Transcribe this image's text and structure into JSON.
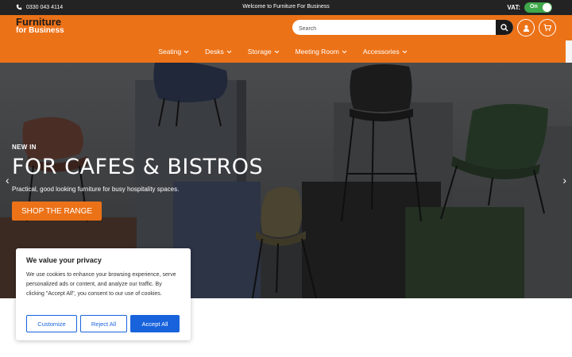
{
  "topbar": {
    "phone": "0330 043 4114",
    "welcome": "Welcome to Furniture For Business",
    "vat_label": "VAT:",
    "vat_toggle": "On",
    "icon": "phone-icon"
  },
  "header": {
    "logo_line1": "Furniture",
    "logo_line2": "for Business",
    "search_placeholder": "Search",
    "icons": [
      "search-icon",
      "user-icon",
      "cart-icon"
    ]
  },
  "nav": {
    "items": [
      {
        "label": "Seating"
      },
      {
        "label": "Desks"
      },
      {
        "label": "Storage"
      },
      {
        "label": "Meeting Room"
      },
      {
        "label": "Accessories"
      }
    ]
  },
  "hero": {
    "eyebrow": "NEW IN",
    "title": "FOR CAFES & BISTROS",
    "subtitle": "Practical, good looking furniture for busy hospitality spaces.",
    "cta": "SHOP THE RANGE"
  },
  "cookie": {
    "title": "We value your privacy",
    "body": "We use cookies to enhance your browsing experience, serve personalized ads or content, and analyze our traffic. By clicking \"Accept All\", you consent to our use of cookies.",
    "customize": "Customize",
    "reject": "Reject All",
    "accept": "Accept All"
  },
  "colors": {
    "brand_orange": "#ec7218",
    "topbar_dark": "#232323",
    "toggle_green": "#3fa84a",
    "cookie_blue": "#1863dc"
  }
}
